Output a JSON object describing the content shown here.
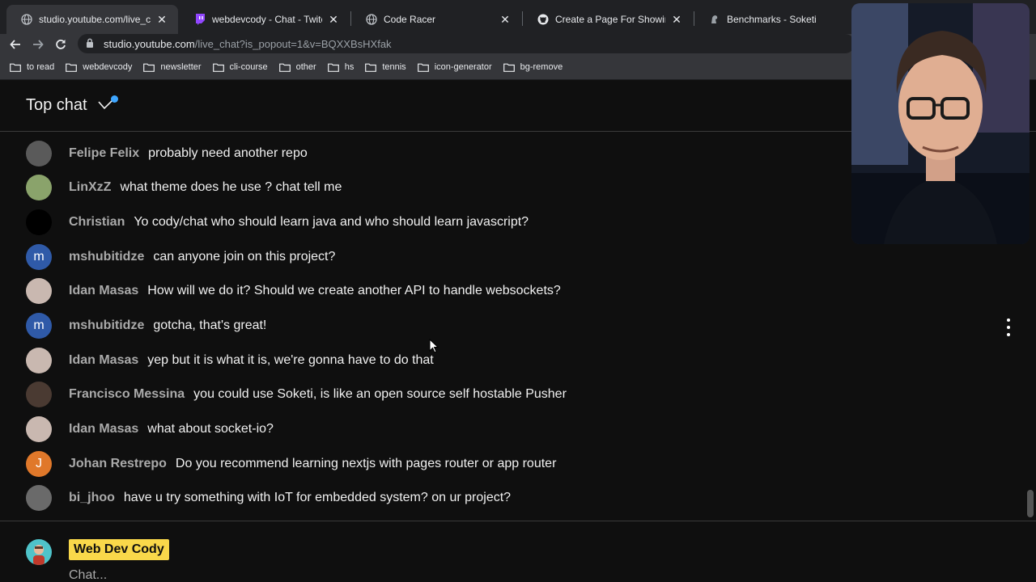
{
  "browser": {
    "tabs": [
      {
        "title": "studio.youtube.com/live_chat?",
        "favicon": "globe-icon",
        "active": true
      },
      {
        "title": "webdevcody - Chat - Twitch",
        "favicon": "twitch-icon",
        "active": false
      },
      {
        "title": "Code Racer",
        "favicon": "globe-icon",
        "active": false
      },
      {
        "title": "Create a Page For Showing Rac",
        "favicon": "github-icon",
        "active": false
      },
      {
        "title": "Benchmarks - Soketi",
        "favicon": "soketi-icon",
        "active": false
      }
    ],
    "url_host": "studio.youtube.com",
    "url_rest": "/live_chat?is_popout=1&v=BQXXBsHXfak",
    "bookmarks": [
      "to read",
      "webdevcody",
      "newsletter",
      "cli-course",
      "other",
      "hs",
      "tennis",
      "icon-generator",
      "bg-remove"
    ]
  },
  "chat": {
    "title": "Top chat",
    "messages": [
      {
        "author": "Felipe Felix",
        "text": "probably need another repo",
        "avatar_color": "#5a5a5a",
        "initial": ""
      },
      {
        "author": "LinXzZ",
        "text": "what theme does he use ? chat tell me",
        "avatar_color": "#8aa36b",
        "initial": ""
      },
      {
        "author": "Christian",
        "text": "Yo cody/chat who should learn java and who should learn javascript?",
        "avatar_color": "#000000",
        "initial": ""
      },
      {
        "author": "mshubitidze",
        "text": "can anyone join on this project?",
        "avatar_color": "#2f5aa8",
        "initial": "m"
      },
      {
        "author": "Idan Masas",
        "text": "How will we do it? Should we create another API to handle websockets?",
        "avatar_color": "#c9b8b0",
        "initial": ""
      },
      {
        "author": "mshubitidze",
        "text": "gotcha, that's great!",
        "avatar_color": "#2f5aa8",
        "initial": "m"
      },
      {
        "author": "Idan Masas",
        "text": "yep but it is what it is, we're gonna have to do that",
        "avatar_color": "#c9b8b0",
        "initial": ""
      },
      {
        "author": "Francisco Messina",
        "text": "you could use Soketi, is like an open source self hostable Pusher",
        "avatar_color": "#4a3a32",
        "initial": ""
      },
      {
        "author": "Idan Masas",
        "text": "what about socket-io?",
        "avatar_color": "#c9b8b0",
        "initial": ""
      },
      {
        "author": "Johan Restrepo",
        "text": "Do you recommend learning nextjs with pages router or app router",
        "avatar_color": "#e0782a",
        "initial": "J"
      },
      {
        "author": "bi_jhoo",
        "text": "have u try something with IoT for embedded system? on ur project?",
        "avatar_color": "#6a6a6a",
        "initial": ""
      }
    ],
    "composer": {
      "channel_name": "Web Dev Cody",
      "placeholder": "Chat..."
    }
  },
  "colors": {
    "accent_blue": "#3ea6ff",
    "name_highlight": "#f9d84a",
    "background": "#0f0f0f"
  }
}
